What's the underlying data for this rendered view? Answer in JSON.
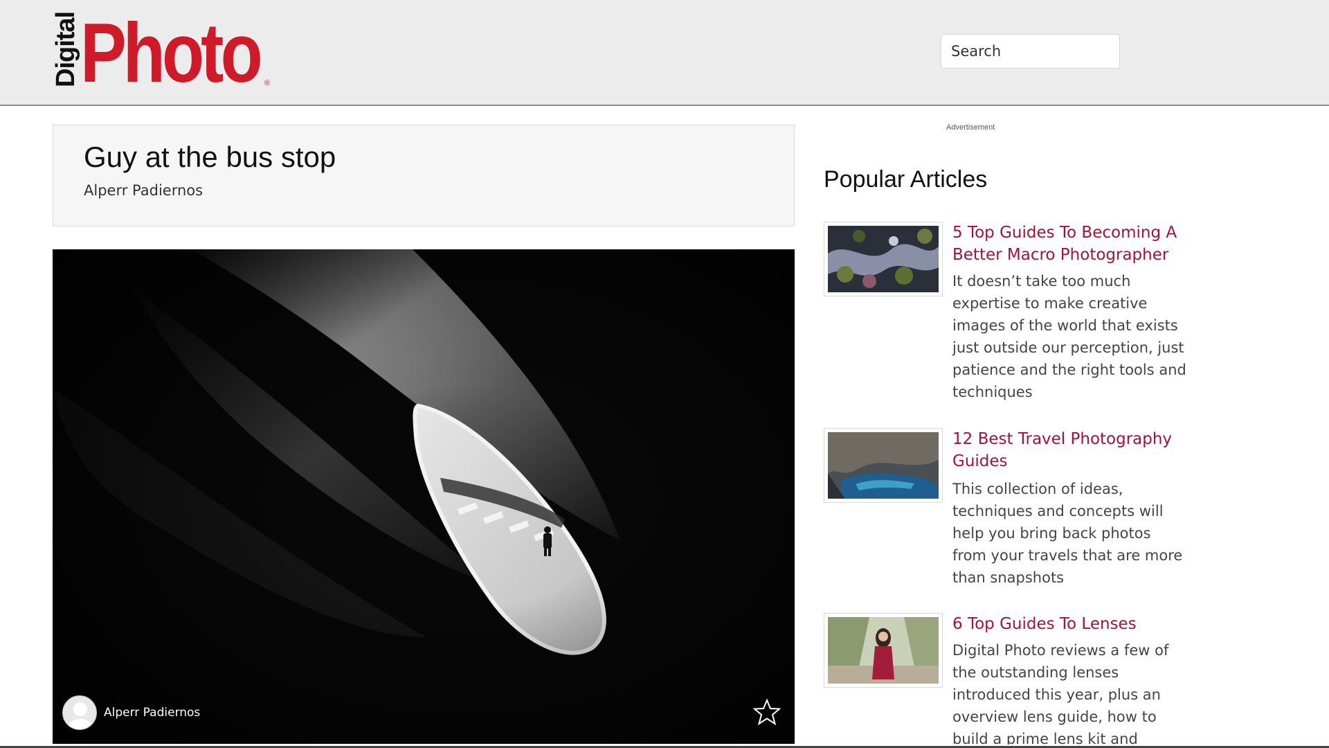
{
  "header": {
    "logo_small": "Digital",
    "logo_big": "Photo",
    "logo_reg": "®",
    "search_placeholder": "Search"
  },
  "post": {
    "title": "Guy at the bus stop",
    "author": "Alperr Padiernos",
    "photo_credit_name": "Alperr Padiernos",
    "favorite_icon": "star-outline-icon"
  },
  "sidebar": {
    "ad_label": "Advertisement",
    "title": "Popular Articles",
    "articles": [
      {
        "title": "5 Top Guides To Becoming A Better Macro Photographer",
        "description": "It doesn’t take too much expertise to make creative images of the world that exists just outside our perception, just patience and the right tools and techniques"
      },
      {
        "title": "12 Best Travel Photography Guides",
        "description": "This collection of ideas, techniques and concepts will help you bring back photos from your travels that are more than snapshots"
      },
      {
        "title": "6 Top Guides To Lenses",
        "description": "Digital Photo reviews a few of the outstanding lenses introduced this year, plus an overview lens guide, how to build a prime lens kit and"
      }
    ]
  },
  "colors": {
    "brand_red": "#cf1a2a",
    "link": "#a3123a",
    "header_bg": "#ececec"
  }
}
